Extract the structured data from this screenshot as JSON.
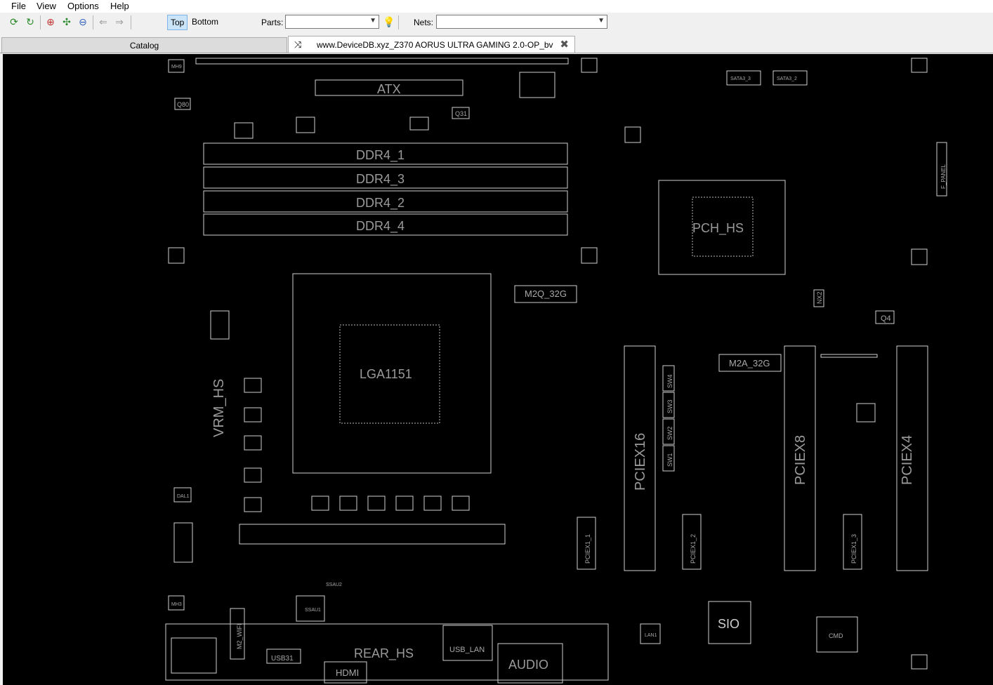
{
  "menubar": {
    "items": [
      "File",
      "View",
      "Options",
      "Help"
    ]
  },
  "toolbar": {
    "icons": [
      "refresh-icon",
      "reload-icon",
      "zoom-in-icon",
      "fit-icon",
      "zoom-out-icon",
      "back-icon",
      "forward-icon"
    ],
    "layer_top": "Top",
    "layer_bottom": "Bottom",
    "parts_label": "Parts:",
    "parts_value": "",
    "nets_label": "Nets:",
    "nets_value": ""
  },
  "tabs": {
    "catalog": "Catalog",
    "document": "www.DeviceDB.xyz_Z370 AORUS ULTRA GAMING 2.0-OP_bv"
  },
  "board": {
    "labels": {
      "atx": "ATX",
      "ddr1": "DDR4_1",
      "ddr3": "DDR4_3",
      "ddr2": "DDR4_2",
      "ddr4": "DDR4_4",
      "m2q": "M2Q_32G",
      "m2a": "M2A_32G",
      "pch": "PCH_HS",
      "socket": "LGA1151",
      "pciex16": "PCIEX16",
      "pciex8": "PCIEX8",
      "pciex4": "PCIEX4",
      "pciex1_1": "PCIEX1_1",
      "pciex1_2": "PCIEX1_2",
      "pciex1_3": "PCIEX1_3",
      "sio": "SIO",
      "audio": "AUDIO",
      "hdmi": "HDMI",
      "usb_lan": "USB_LAN",
      "rear_hs": "REAR_HS",
      "usb31": "USB31",
      "q31": "Q31",
      "q4": "Q4",
      "q80": "Q80",
      "sata1": "SATA3_3",
      "sata2": "SATA3_2",
      "fpanel": "F_PANEL",
      "m2_wifi": "M2_WIFI",
      "cpu_vrm": "VRM_HS",
      "ssau1": "SSAU1",
      "ssau2": "SSAU2",
      "sw4": "SW4",
      "sw3": "SW3",
      "sw2": "SW2",
      "sw1": "SW1",
      "nx2": "NX2",
      "cmd": "CMD",
      "lan1": "LAN1",
      "dal1": "DAL1",
      "mh_tl": "MH9",
      "mh_bl": "MH3"
    }
  }
}
